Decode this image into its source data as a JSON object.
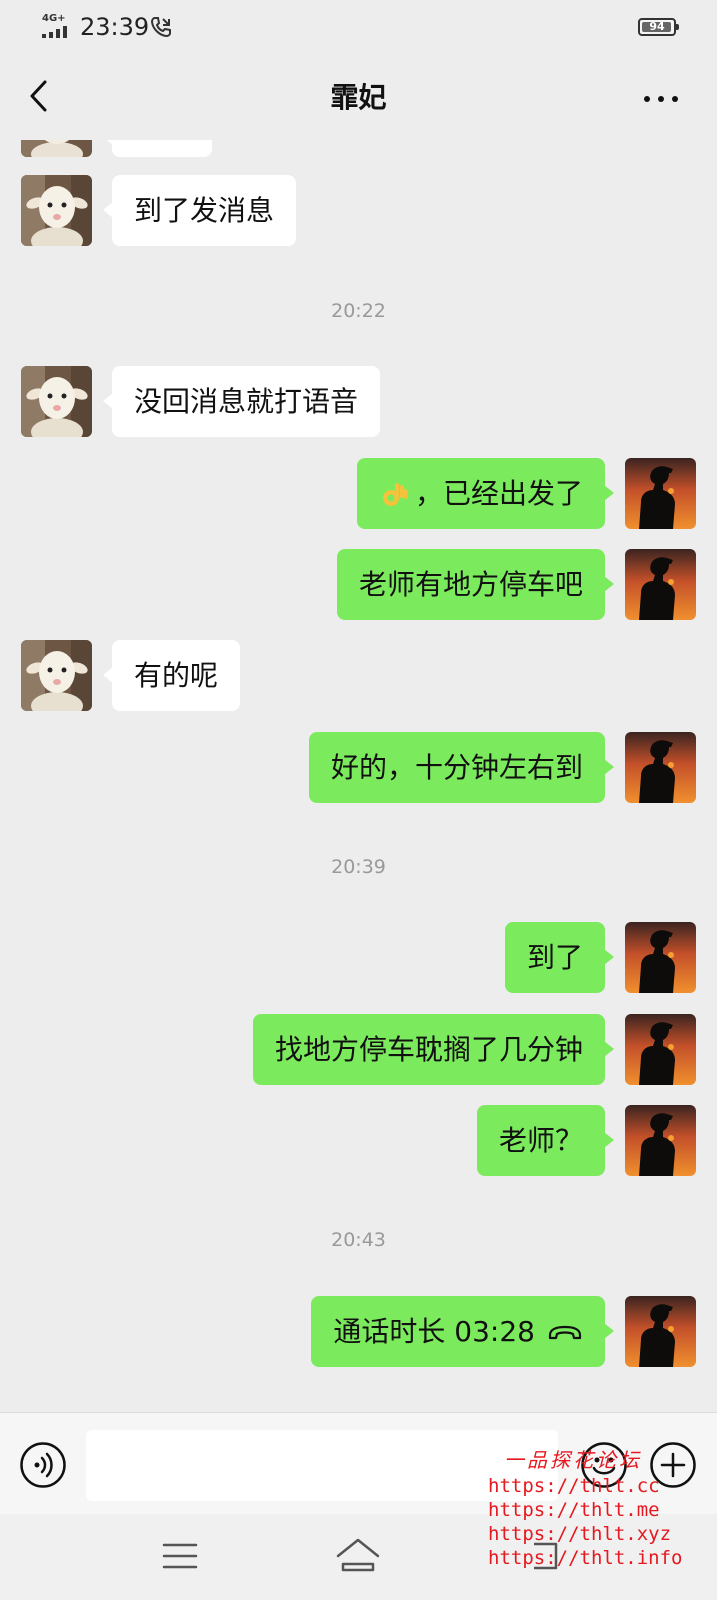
{
  "status_bar": {
    "network": "4G+",
    "time": "23:39",
    "battery": "94",
    "battery_level_percent": 94
  },
  "header": {
    "title": "霏妃",
    "back_icon": "chevron-left-icon",
    "more_icon": "more-horizontal-icon"
  },
  "messages": [
    {
      "side": "left",
      "text": "到了发消息"
    },
    {
      "type": "time",
      "text": "20:22"
    },
    {
      "side": "left",
      "text": "没回消息就打语音"
    },
    {
      "side": "right",
      "emoji": "ok-hand-emoji",
      "text": "，已经出发了"
    },
    {
      "side": "right",
      "text": "老师有地方停车吧"
    },
    {
      "side": "left",
      "text": "有的呢"
    },
    {
      "side": "right",
      "text": "好的，十分钟左右到"
    },
    {
      "type": "time",
      "text": "20:39"
    },
    {
      "side": "right",
      "text": "到了"
    },
    {
      "side": "right",
      "text": "找地方停车耽搁了几分钟"
    },
    {
      "side": "right",
      "text": "老师？"
    },
    {
      "type": "time",
      "text": "20:43"
    },
    {
      "side": "right",
      "text": "通话时长 03:28",
      "icon": "phone-hangup-icon"
    }
  ],
  "input_bar": {
    "voice_icon": "voice-mode-icon",
    "emoji_icon": "smiley-icon",
    "plus_icon": "plus-circle-icon",
    "placeholder": ""
  },
  "nav_bar": {
    "menu_icon": "menu-icon",
    "home_icon": "home-icon",
    "back_icon": "back-icon"
  },
  "watermark": {
    "title": "一品探花论坛",
    "lines": [
      "https://thlt.cc",
      "https://thlt.me",
      "https://thlt.xyz",
      "https://thlt.info"
    ]
  },
  "colors": {
    "background": "#ededed",
    "bubble_self": "#7bea5d",
    "bubble_other": "#ffffff",
    "watermark": "#e5191f"
  }
}
